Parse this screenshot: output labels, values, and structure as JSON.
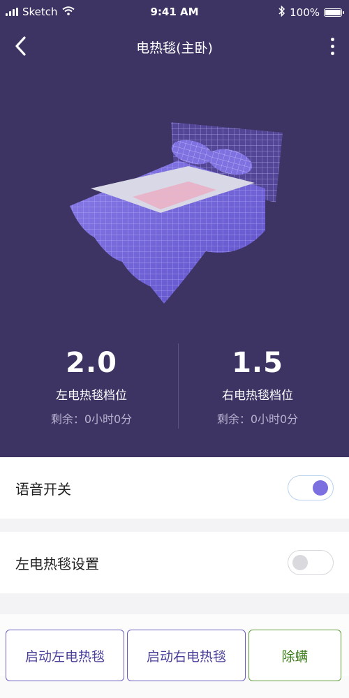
{
  "status_bar": {
    "carrier": "Sketch",
    "time": "9:41 AM",
    "battery": "100%"
  },
  "navbar": {
    "title": "电热毯(主卧)"
  },
  "icons": {
    "back": "chevron-left-icon",
    "more": "more-vertical-icon",
    "bluetooth": "bluetooth-icon",
    "wifi": "wifi-icon",
    "signal": "signal-icon",
    "battery": "battery-icon"
  },
  "stats": {
    "left": {
      "value": "2.0",
      "label": "左电热毯档位",
      "remaining": "剩余：0小时0分"
    },
    "right": {
      "value": "1.5",
      "label": "右电热毯档位",
      "remaining": "剩余：0小时0分"
    }
  },
  "settings": {
    "voice_switch": {
      "label": "语音开关",
      "on": true
    },
    "left_blanket": {
      "label": "左电热毯设置",
      "on": false
    }
  },
  "buttons": {
    "start_left": "启动左电热毯",
    "start_right": "启动右电热毯",
    "dust_mite": "除螨"
  },
  "colors": {
    "header_bg": "#3d3464",
    "accent": "#7c6fe0",
    "button_border": "#6a5fc0",
    "dust_mite_green": "#3e7d1c"
  }
}
